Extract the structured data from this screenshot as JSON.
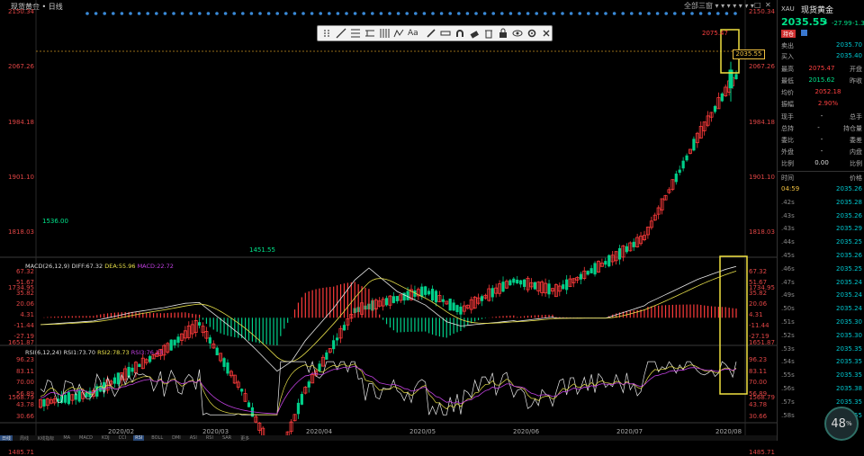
{
  "header": {
    "title": "现货黄金 • 日线",
    "right_controls": "全部三窗 ▾ ▾ ▾ ▾ ▾ ▾ ▾",
    "max_btn": "□",
    "close_btn": "✕"
  },
  "main_axis": {
    "right_labels": [
      "2150.34",
      "2067.26",
      "1984.18",
      "1901.10",
      "1818.03",
      "1734.95",
      "1651.87",
      "1568.79",
      "1485.71"
    ],
    "left_labels": [
      "2150.34",
      "2067.26",
      "1984.18",
      "1901.10",
      "1818.03",
      "1734.95",
      "1651.87",
      "1568.79",
      "1485.71"
    ],
    "current_price_tag": "2035.55",
    "high_annotation": "2075.47",
    "low_annotation": "1451.55",
    "start_annotation": "1536.00"
  },
  "toolbar": {
    "text_btn": "Aa"
  },
  "macd": {
    "title": "MACD(26,12,9)",
    "diff": "DIFF:67.32",
    "dea": "DEA:55.96",
    "macd": "MACD:22.72",
    "labels": [
      "67.32",
      "51.67",
      "35.82",
      "20.06",
      "4.31",
      "-11.44",
      "-27.19"
    ]
  },
  "rsi": {
    "title": "RSI(6,12,24)",
    "rsi1": "RSI1:73.70",
    "rsi2": "RSI2:78.73",
    "rsi3": "RSI3:76.23",
    "labels": [
      "96.23",
      "83.11",
      "70.00",
      "56.89",
      "43.78",
      "30.66"
    ]
  },
  "x_axis": {
    "labels": [
      "2020/02",
      "2020/03",
      "2020/04",
      "2020/05",
      "2020/06",
      "2020/07",
      "2020/08"
    ]
  },
  "bottom_tabs": [
    "日线",
    "周线",
    "K线指标",
    "MA",
    "MACD",
    "KDJ",
    "CCI",
    "RSI",
    "BOLL",
    "DMI",
    "ASI",
    "RSI",
    "SAR",
    "更多"
  ],
  "bottom_active": "RSI",
  "panel": {
    "symbol": "XAU",
    "name": "现货黄金",
    "price": "2035.55",
    "arrow": "⬇",
    "change": "-27.99",
    "change_pct": "-1.36",
    "chip1": "持仓",
    "sell_label": "卖出",
    "sell_value": "2035.70",
    "buy_label": "买入",
    "buy_value": "2035.40",
    "high_label": "最高",
    "high_value": "2075.47",
    "open_label": "开盘",
    "low_label": "最低",
    "low_value": "2015.62",
    "prev_label": "昨收",
    "avg_label": "均价",
    "avg_value": "2052.18",
    "amp_label": "振幅",
    "amp_value": "2.90%",
    "now_label": "现手",
    "now_value": "-",
    "total_hands": "总手",
    "total_label": "总持",
    "total_value": "-",
    "position_label": "持仓量",
    "diff_label": "委比",
    "diff_value": "-",
    "entrust_label": "委差",
    "outer_label": "外盘",
    "outer_value": "-",
    "inner_label": "内盘",
    "ratio_label": "比例",
    "ratio_value": "0.00",
    "ratio2_label": "比例",
    "ticks_time_header": "时间",
    "ticks_price_header": "价格",
    "ticks": [
      {
        "t": "04:59",
        "p": "2035.26"
      },
      {
        "t": ".42s",
        "p": "2035.28"
      },
      {
        "t": ".43s",
        "p": "2035.26"
      },
      {
        "t": ".43s",
        "p": "2035.29"
      },
      {
        "t": ".44s",
        "p": "2035.25"
      },
      {
        "t": ".45s",
        "p": "2035.26"
      },
      {
        "t": ".46s",
        "p": "2035.25"
      },
      {
        "t": ".47s",
        "p": "2035.24"
      },
      {
        "t": ".49s",
        "p": "2035.24"
      },
      {
        "t": ".50s",
        "p": "2035.24"
      },
      {
        "t": ".51s",
        "p": "2035.30"
      },
      {
        "t": ".52s",
        "p": "2035.30"
      },
      {
        "t": ".53s",
        "p": "2035.35"
      },
      {
        "t": ".54s",
        "p": "2035.35"
      },
      {
        "t": ".55s",
        "p": "2035.35"
      },
      {
        "t": ".56s",
        "p": "2035.38"
      },
      {
        "t": ".57s",
        "p": "2035.35"
      },
      {
        "t": ".58s",
        "p": "2035.55"
      }
    ]
  },
  "badge": "48",
  "badge_unit": "%",
  "colors": {
    "up": "#ff3b3b",
    "down": "#00d08a",
    "diff_line": "#e8e8e8",
    "dea_line": "#e8e04a",
    "rsi3_line": "#c040e0",
    "highlight_box": "#f0e040"
  }
}
